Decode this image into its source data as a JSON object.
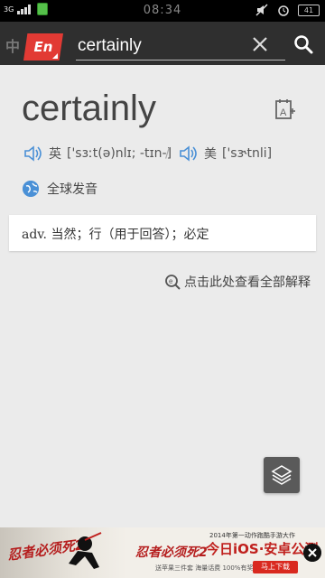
{
  "status_bar": {
    "network": "3G",
    "time": "08:34",
    "battery": "41"
  },
  "search": {
    "lang_bg": "中",
    "lang_label": "En",
    "query": "certainly"
  },
  "entry": {
    "word": "certainly",
    "pron_uk_label": "英",
    "pron_uk": "['sɜːt(ə)nlɪ; -tɪn-]",
    "pron_separator": "/",
    "pron_us_label": "美",
    "pron_us": "['sɝtnli]",
    "global_pron": "全球发音",
    "definition_pos": "adv.",
    "definition": "当然；行（用于回答）；必定",
    "full_explain_link": "点击此处查看全部解释"
  },
  "ad": {
    "logo_left": "忍者必须死2",
    "tagline": "2014年第一动作跑酷手游大作",
    "title": "忍者必须死2",
    "headline": "今日iOS·安卓公测",
    "small_text": "送苹果三件套 海量话费 100%有奖",
    "download_label": "马上下载"
  },
  "colors": {
    "accent_red": "#e23a34",
    "speaker_blue": "#4a90d6",
    "searchbar_bg": "#2f2f2f",
    "page_bg": "#ebebeb"
  },
  "icons": {
    "clear": "close-icon",
    "search": "search-icon",
    "wordbook": "add-to-wordbook-icon",
    "speaker": "speaker-icon",
    "globe": "globe-icon",
    "magnifier": "magnifier-icon",
    "layers": "layers-icon"
  }
}
